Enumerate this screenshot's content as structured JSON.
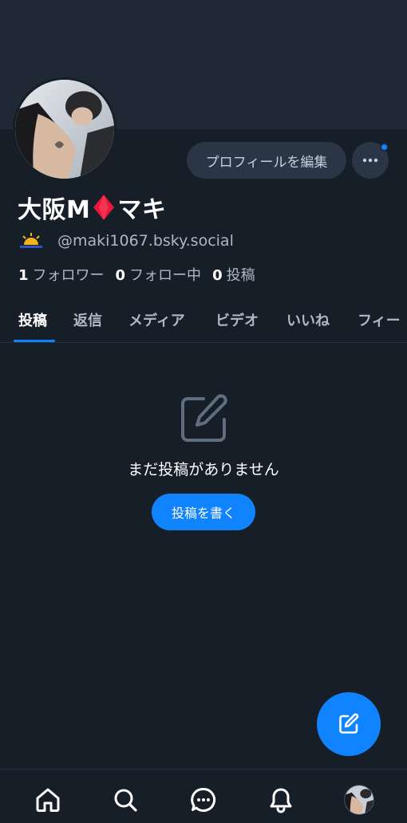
{
  "profile": {
    "display_name_prefix": "大阪M",
    "display_name_suffix": "マキ",
    "emoji_name": "diamond-icon",
    "handle": "@maki1067.bsky.social",
    "status_icon": "sunrise-icon"
  },
  "actions": {
    "edit_profile_label": "プロフィールを編集",
    "more_icon": "ellipsis-icon"
  },
  "stats": {
    "followers_count": "1",
    "followers_label": "フォロワー",
    "following_count": "0",
    "following_label": "フォロー中",
    "posts_count": "0",
    "posts_label": "投稿"
  },
  "tabs": [
    {
      "label": "投稿",
      "active": true
    },
    {
      "label": "返信"
    },
    {
      "label": "メディア"
    },
    {
      "label": "ビデオ"
    },
    {
      "label": "いいね"
    },
    {
      "label": "フィー"
    }
  ],
  "empty_state": {
    "icon": "compose-icon",
    "message": "まだ投稿がありません",
    "button_label": "投稿を書く"
  },
  "fab": {
    "icon": "compose-icon"
  },
  "bottom_nav": [
    {
      "name": "home-icon"
    },
    {
      "name": "search-icon"
    },
    {
      "name": "chat-icon"
    },
    {
      "name": "bell-icon"
    },
    {
      "name": "profile-avatar"
    }
  ],
  "colors": {
    "background": "#161e27",
    "banner": "#1e2935",
    "accent": "#1083fe",
    "muted_text": "#aeb9c6",
    "diamond": "#e8163a"
  }
}
